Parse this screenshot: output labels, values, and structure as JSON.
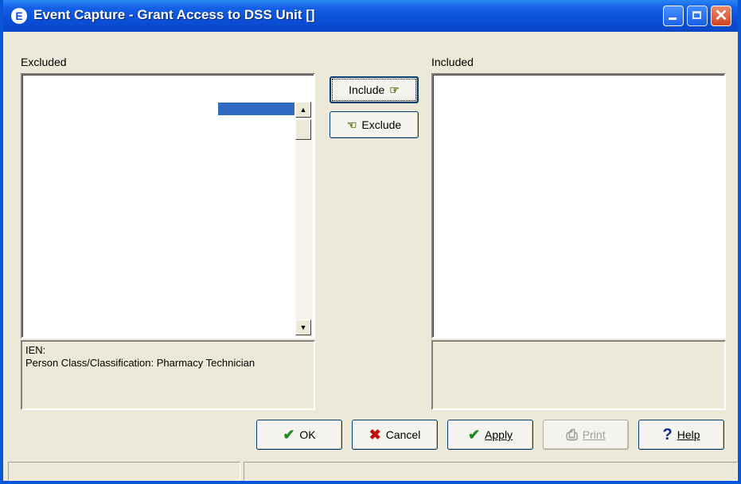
{
  "window": {
    "title": "Event Capture - Grant Access to DSS Unit []",
    "app_icon": "E"
  },
  "excluded": {
    "label": "Excluded",
    "items": []
  },
  "included": {
    "label": "Included",
    "items": []
  },
  "buttons": {
    "include": "Include",
    "exclude": "Exclude"
  },
  "info": {
    "ien": "IEN:",
    "person_class": "Person Class/Classification: Pharmacy Technician"
  },
  "actions": {
    "ok": "OK",
    "cancel": "Cancel",
    "apply": "Apply",
    "print": "Print",
    "help": "Help"
  },
  "status": {
    "panel1": "",
    "panel2": ""
  },
  "icons": {
    "include": "hand-right-icon",
    "exclude": "hand-left-icon",
    "ok": "check-icon",
    "cancel": "x-icon",
    "apply": "check-icon",
    "print": "printer-icon",
    "help": "question-icon"
  },
  "colors": {
    "titlebar": "#0a50d8",
    "selection": "#316ac5",
    "face": "#ece9d8"
  }
}
